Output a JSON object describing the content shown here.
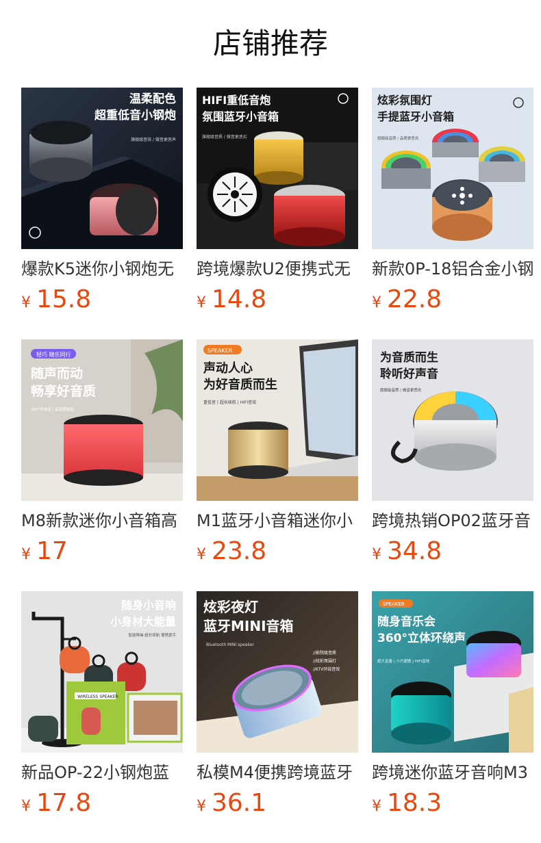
{
  "section": {
    "title": "店铺推荐"
  },
  "currency": "¥",
  "products": [
    {
      "name": "爆款K5迷你小钢炮无",
      "price": "15.8",
      "banner": {
        "line1": "温柔配色",
        "line2": "超重低音小钢炮",
        "sub": "旗舰级音效 / 做音更恶声",
        "colors": {
          "bg": "#1c2330",
          "accent": "#e88a8f"
        }
      }
    },
    {
      "name": "跨境爆款U2便携式无",
      "price": "14.8",
      "banner": {
        "line1": "HIFI重低音炮",
        "line2": "氛围蓝牙小音箱",
        "sub": "旗舰级音质 / 做音更恶劣",
        "colors": {
          "bg": "#1a1a1a",
          "accent": "#d42a2a"
        }
      }
    },
    {
      "name": "新款0P-18铝合金小钢",
      "price": "22.8",
      "banner": {
        "line1": "炫彩氛围灯",
        "line2": "手提蓝牙小音箱",
        "sub": "旗舰级音质 / 品质更恶劣",
        "colors": {
          "bg": "#dfe6ee",
          "accent": "#2e3440"
        }
      }
    },
    {
      "name": "M8新款迷你小音箱高",
      "price": "17",
      "banner": {
        "badge": "轻巧 随乐同行",
        "line1": "随声而动",
        "line2": "畅享好音质",
        "sub": "360°环绕音 / 高音质做音",
        "colors": {
          "bg": "#d9d4cd",
          "accent": "#f04a4f"
        }
      }
    },
    {
      "name": "M1蓝牙小音箱迷你小",
      "price": "23.8",
      "banner": {
        "badge": "SPEAKER",
        "line1": "声动人心",
        "line2": "为好音质而生",
        "sub": "重低音 | 超长续航 | HIFI音效",
        "colors": {
          "bg": "#e9e6df",
          "accent": "#d9b870"
        }
      }
    },
    {
      "name": "跨境热销OP02蓝牙音",
      "price": "34.8",
      "banner": {
        "line1": "为音质而生",
        "line2": "聆听好声音",
        "sub": "旗舰级音质 / 做音更恶劣",
        "colors": {
          "bg": "#e3e5e8",
          "accent": "#c9ccd0"
        }
      }
    },
    {
      "name": "新品OP-22小钢炮蓝",
      "price": "17.8",
      "banner": {
        "line1": "随身小音响",
        "line2": "小身材大能量",
        "sub": "智能降噪  超长续航  便携提手",
        "box": "WIRELESS SPEAKER",
        "colors": {
          "bg": "#e6e6e6",
          "accent": "#9fc93c"
        }
      }
    },
    {
      "name": "私模M4便携跨境蓝牙",
      "price": "36.1",
      "banner": {
        "line1": "炫彩夜灯",
        "line2": "蓝牙MINI音箱",
        "sub": "Bluetooth MINI speaker",
        "bullets": [
          "//影院级音质",
          "//炫彩氛围灯",
          "//KTV环绕音效"
        ],
        "colors": {
          "bg": "#3a2f2a",
          "accent": "#a9c6e6"
        }
      }
    },
    {
      "name": "跨境迷你蓝牙音响M3",
      "price": "18.3",
      "banner": {
        "badge": "SPEAKER",
        "line1": "随身音乐会",
        "line2": "360°立体环绕声",
        "sub": "超大音量 | 小巧便携 | HIFI音效",
        "colors": {
          "bg": "#3f8f98",
          "accent": "#1fc7c4"
        }
      }
    }
  ]
}
